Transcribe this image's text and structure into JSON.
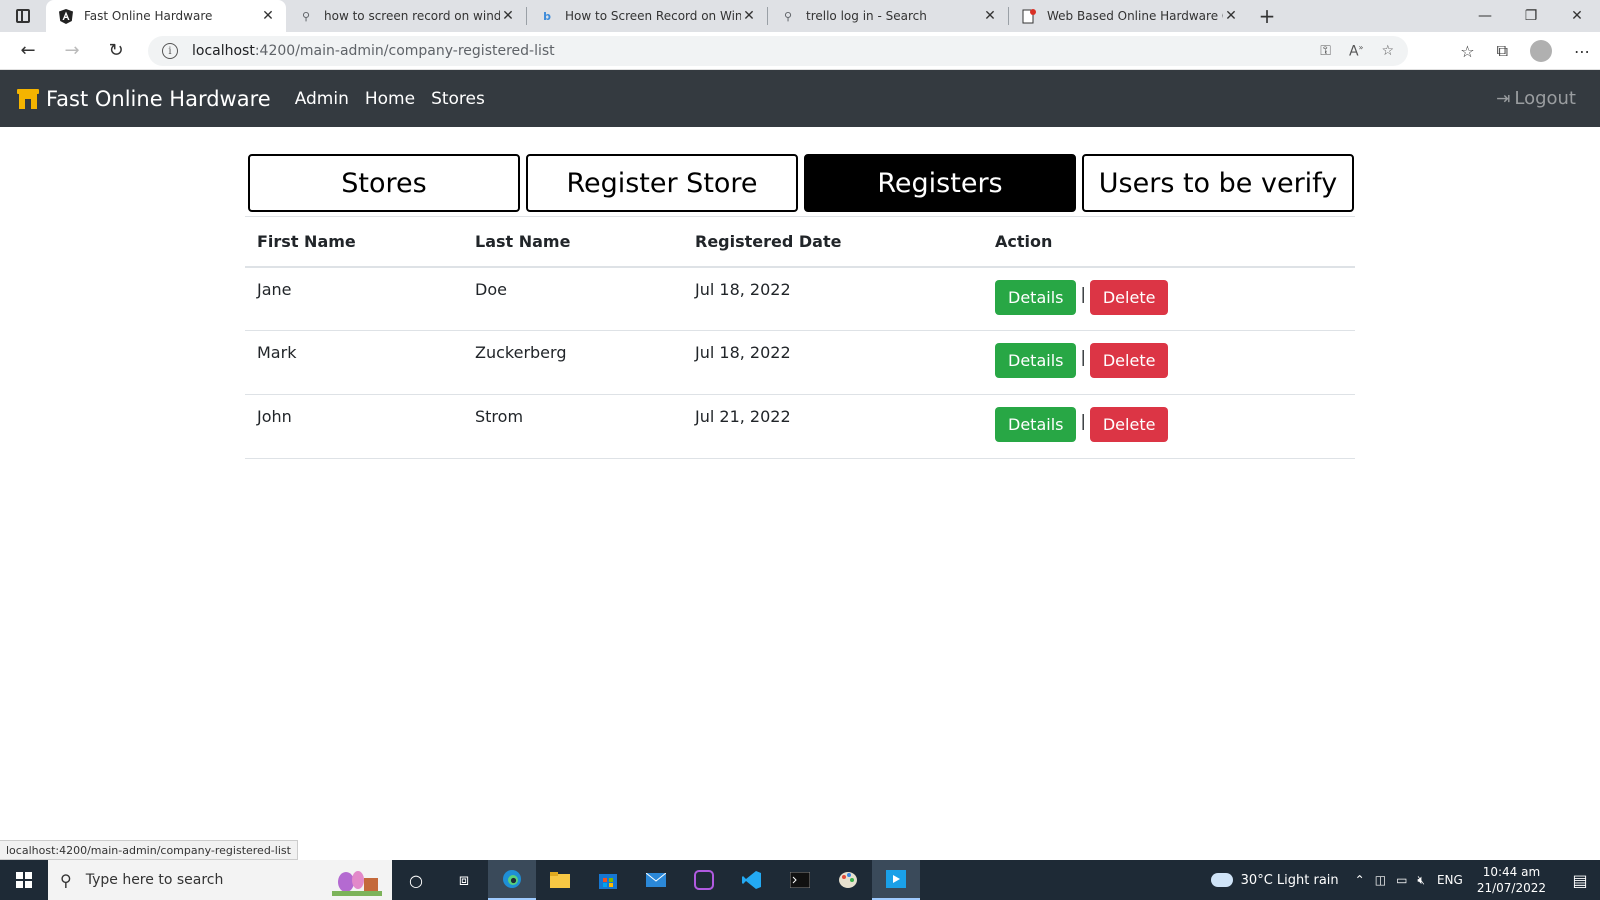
{
  "browser": {
    "tabs": [
      {
        "label": "Fast Online Hardware",
        "active": true
      },
      {
        "label": "how to screen record on window"
      },
      {
        "label": "How to Screen Record on Windo"
      },
      {
        "label": "trello log in - Search"
      },
      {
        "label": "Web Based Online Hardware Ord"
      }
    ],
    "url_host": "localhost",
    "url_path": ":4200/main-admin/company-registered-list"
  },
  "navbar": {
    "brand": "Fast Online Hardware",
    "links": [
      "Admin",
      "Home",
      "Stores"
    ],
    "logout": "Logout"
  },
  "tabs": [
    {
      "label": "Stores",
      "active": false
    },
    {
      "label": "Register Store",
      "active": false
    },
    {
      "label": "Registers",
      "active": true
    },
    {
      "label": "Users to be verify",
      "active": false
    }
  ],
  "table": {
    "headers": [
      "First Name",
      "Last Name",
      "Registered Date",
      "Action"
    ],
    "rows": [
      {
        "first": "Jane",
        "last": "Doe",
        "date": "Jul 18, 2022"
      },
      {
        "first": "Mark",
        "last": "Zuckerberg",
        "date": "Jul 18, 2022"
      },
      {
        "first": "John",
        "last": "Strom",
        "date": "Jul 21, 2022"
      }
    ],
    "details_label": "Details",
    "delete_label": "Delete",
    "separator": "|"
  },
  "status_url": "localhost:4200/main-admin/company-registered-list",
  "taskbar": {
    "search_placeholder": "Type here to search",
    "weather": "30°C  Light rain",
    "lang": "ENG",
    "time": "10:44 am",
    "date": "21/07/2022"
  },
  "colors": {
    "navbar": "#343a40",
    "details": "#28a745",
    "delete": "#dc3545",
    "brand_icon": "#f5b400"
  }
}
